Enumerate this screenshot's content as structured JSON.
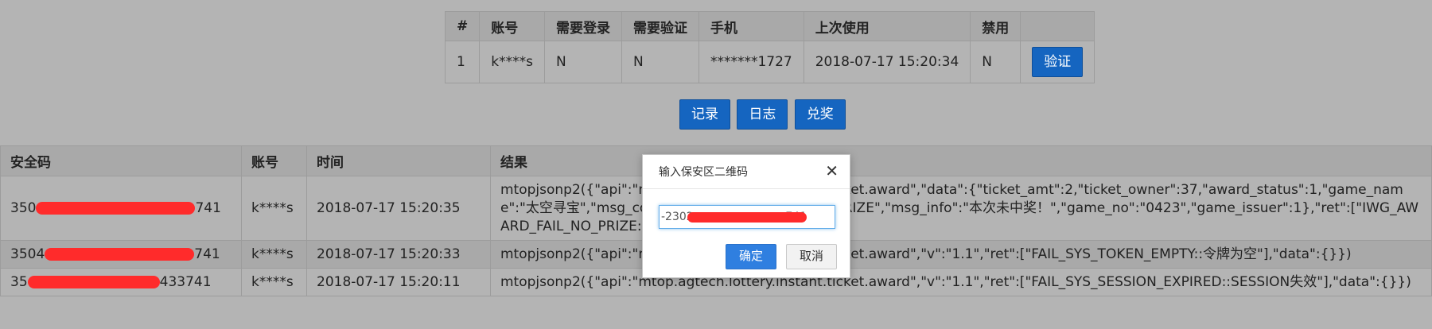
{
  "accounts": {
    "headers": [
      "#",
      "账号",
      "需要登录",
      "需要验证",
      "手机",
      "上次使用",
      "禁用",
      ""
    ],
    "rows": [
      {
        "index": "1",
        "account": "k****s",
        "need_login": "N",
        "need_verify": "N",
        "phone": "*******1727",
        "last_used": "2018-07-17 15:20:34",
        "disabled": "N",
        "action": "验证"
      }
    ]
  },
  "actions": {
    "record": "记录",
    "log": "日志",
    "redeem": "兑奖"
  },
  "history": {
    "headers": [
      "安全码",
      "账号",
      "时间",
      "结果"
    ],
    "rows": [
      {
        "code_start": "350",
        "code_end": "741",
        "account": "k****s",
        "time": "2018-07-17 15:20:35",
        "result": "mtopjsonp2({\"api\":\"mtop.agtech.lottery.instant.ticket.award\",\"data\":{\"ticket_amt\":2,\"ticket_owner\":37,\"award_status\":1,\"game_name\":\"太空寻宝\",\"msg_code\":\"IWG_AWARD_FAIL_NO_PRIZE\",\"msg_info\":\"本次未中奖！\",\"game_no\":\"0423\",\"game_issuer\":1},\"ret\":[\"IWG_AWARD_FAIL_NO_PRIZE::本次未中奖！\"],\"v\":\"1.1\"})"
      },
      {
        "code_start": "3504",
        "code_end": "741",
        "account": "k****s",
        "time": "2018-07-17 15:20:33",
        "result": "mtopjsonp2({\"api\":\"mtop.agtech.lottery.instant.ticket.award\",\"v\":\"1.1\",\"ret\":[\"FAIL_SYS_TOKEN_EMPTY::令牌为空\"],\"data\":{}})"
      },
      {
        "code_start": "35",
        "code_end": "433741",
        "account": "k****s",
        "time": "2018-07-17 15:20:11",
        "result": "mtopjsonp2({\"api\":\"mtop.agtech.lottery.instant.ticket.award\",\"v\":\"1.1\",\"ret\":[\"FAIL_SYS_SESSION_EXPIRED::SESSION失效\"],\"data\":{}})"
      }
    ]
  },
  "dialog": {
    "title": "输入保安区二维码",
    "input_value": "-2302                          741",
    "ok_label": "确定",
    "cancel_label": "取消",
    "close_icon": "close-icon"
  },
  "colors": {
    "primary": "#1565c0",
    "overlay": "#b4b4b4",
    "redaction": "#ff2b2b"
  }
}
